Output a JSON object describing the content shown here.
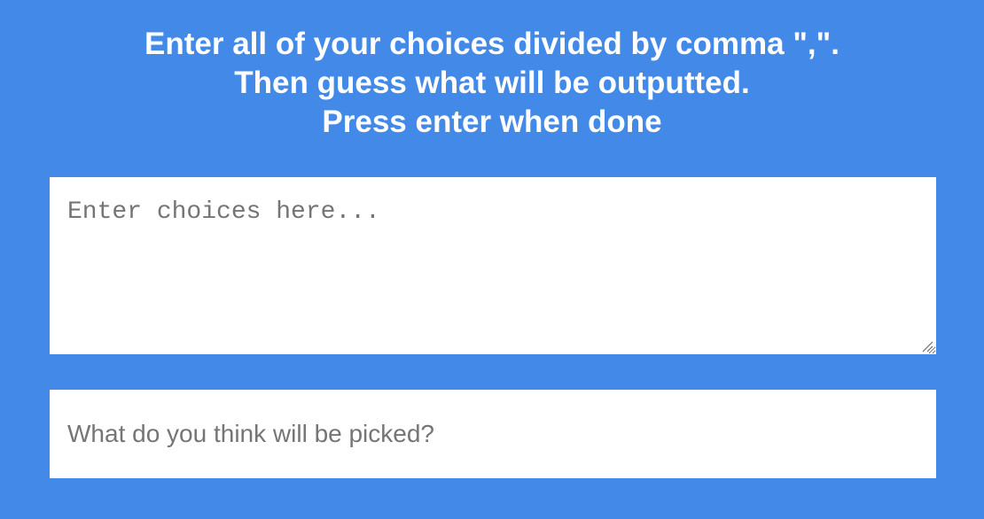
{
  "heading": {
    "line1": "Enter all of your choices divided by comma \",\".",
    "line2": "Then guess what will be outputted.",
    "line3": "Press enter when done"
  },
  "choices_input": {
    "value": "",
    "placeholder": "Enter choices here..."
  },
  "guess_input": {
    "value": "",
    "placeholder": "What do you think will be picked?"
  },
  "colors": {
    "background": "#4389e8",
    "heading_text": "#ffffff",
    "input_background": "#ffffff",
    "placeholder_text": "#757575"
  },
  "icons": {
    "resize_grip": "resize-grip-icon"
  }
}
